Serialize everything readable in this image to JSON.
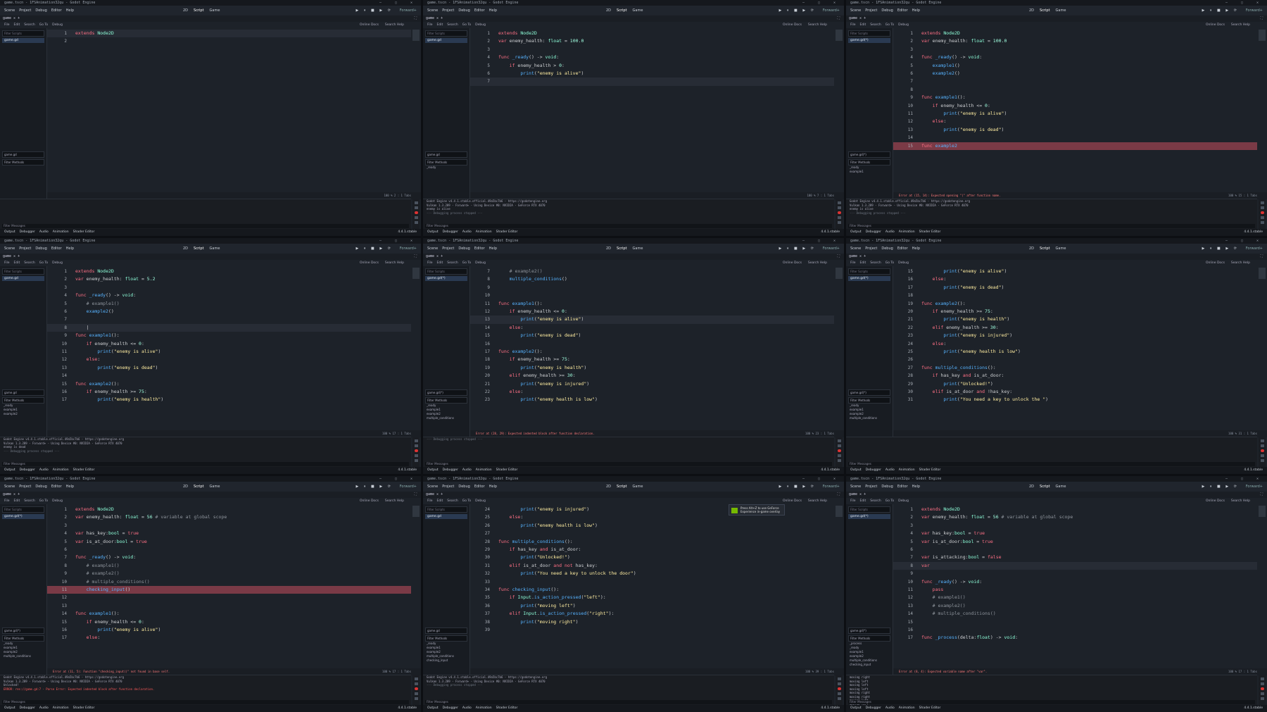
{
  "window_title": "game.tscn - 1FSAnimation32qu - Godot Engine",
  "menu": [
    "Scene",
    "Project",
    "Debug",
    "Editor",
    "Help"
  ],
  "workspaces": [
    "2D",
    "Script",
    "Game"
  ],
  "renderer": "Forward+",
  "tab_name": "game",
  "tab_name_modified": "game",
  "script_menu": [
    "File",
    "Edit",
    "Search",
    "Go To",
    "Debug"
  ],
  "online_docs": "Online Docs",
  "search_help": "Search Help",
  "filter_scripts": "Filter Scripts",
  "filter_methods": "Filter Methods",
  "filter_messages": "Filter Messages",
  "bottom_tabs": [
    "Output",
    "Debugger",
    "Audio",
    "Animation",
    "Shader Editor"
  ],
  "version": "4.4.1.stable",
  "tabs_label": "Tabs",
  "nvidia_popup": "Press Alt+Z to use GeForce Experience in-game overlay",
  "panels": [
    {
      "script_file": "game.gd",
      "line_start": 1,
      "code": [
        "extends Node2D",
        ""
      ],
      "highlight_line": 1,
      "error_line": null,
      "methods": [],
      "status_error": "",
      "output": [],
      "show_nvidia": false
    },
    {
      "script_file": "game.gd",
      "line_start": 1,
      "code": [
        "extends Node2D",
        "var enemy_health: float = 100.0",
        "",
        "func _ready() -> void:",
        "    if enemy_health > 0:",
        "        print(\"enemy is alive\")",
        ""
      ],
      "highlight_line": 7,
      "error_line": null,
      "methods": [
        "_ready"
      ],
      "status_error": "",
      "output": [
        "Godot Engine v4.4.1.stable.official.49a5bc7b6 - https://godotengine.org",
        "Vulkan 1.3.289 - Forward+ - Using Device #0: NVIDIA - GeForce RTX 4070",
        "",
        "enemy is alive",
        "--- Debugging process stopped ---"
      ],
      "show_nvidia": false
    },
    {
      "script_file": "game.gd(*)",
      "line_start": 1,
      "code": [
        "extends Node2D",
        "var enemy_health: float = 100.0",
        "",
        "func _ready() -> void:",
        "    example1()",
        "    example2()",
        "",
        "",
        "func example1():",
        "    if enemy_health <= 0:",
        "        print(\"enemy is alive\")",
        "    else:",
        "        print(\"enemy is dead\")",
        "",
        "func example2"
      ],
      "highlight_line": null,
      "error_line": 15,
      "methods": [
        "_ready",
        "example1"
      ],
      "status_error": "Error at (15, 14): Expected opening \"(\" after function name.",
      "output": [
        "Godot Engine v4.4.1.stable.official.49a5bc7b6 - https://godotengine.org",
        "Vulkan 1.3.289 - Forward+ - Using Device #0: NVIDIA - GeForce RTX 4070",
        "",
        "enemy is alive",
        "--- Debugging process stopped ---"
      ],
      "show_nvidia": false
    },
    {
      "script_file": "game.gd",
      "line_start": 1,
      "code": [
        "extends Node2D",
        "var enemy_health: float = 5.2",
        "",
        "func _ready() -> void:",
        "    # example1()",
        "    example2()",
        "",
        "    |",
        "func example1():",
        "    if enemy_health <= 0:",
        "        print(\"enemy is alive\")",
        "    else:",
        "        print(\"enemy is dead\")",
        "",
        "func example2():",
        "    if enemy_health >= 75:",
        "        print(\"enemy is health\")"
      ],
      "highlight_line": 8,
      "error_line": null,
      "methods": [
        "_ready",
        "example1",
        "example2"
      ],
      "status_error": "",
      "output": [
        "Godot Engine v4.4.1.stable.official.49a5bc7b6 - https://godotengine.org",
        "Vulkan 1.3.289 - Forward+ - Using Device #0: NVIDIA - GeForce RTX 4070",
        "",
        "enemy is dead",
        "--- Debugging process stopped ---"
      ],
      "show_nvidia": false
    },
    {
      "script_file": "game.gd(*)",
      "line_start": 7,
      "code": [
        "    # example2()",
        "    multiple_conditions()",
        "",
        "",
        "func example1():",
        "    if enemy_health <= 0:",
        "        print(\"enemy is alive\")",
        "    else:",
        "        print(\"enemy is dead\")",
        "",
        "func example2():",
        "    if enemy_health >= 75:",
        "        print(\"enemy is health\")",
        "    elif enemy_health >= 30:",
        "        print(\"enemy is injured\")",
        "    else:",
        "        print(\"enemy health is low\")"
      ],
      "highlight_line": 13,
      "error_line": null,
      "methods": [
        "_ready",
        "example1",
        "example2",
        "multiple_conditions"
      ],
      "status_error": "Error at (28, 29): Expected indented block after function declaration.",
      "output": [
        "--- Debugging process stopped ---"
      ],
      "show_nvidia": false
    },
    {
      "script_file": "game.gd(*)",
      "line_start": 15,
      "code": [
        "        print(\"enemy is alive\")",
        "    else:",
        "        print(\"enemy is dead\")",
        "",
        "func example2():",
        "    if enemy_health >= 75:",
        "        print(\"enemy is health\")",
        "    elif enemy_health >= 30:",
        "        print(\"enemy is injured\")",
        "    else:",
        "        print(\"enemy health is low\")",
        "",
        "func multiple_conditions():",
        "    if has_key and is_at_door:",
        "        print(\"Unlocked!\")",
        "    elif is_at_door and !has_key:",
        "        print(\"You need a key to unlock the \")"
      ],
      "highlight_line": null,
      "error_line": null,
      "methods": [
        "_ready",
        "example1",
        "example2",
        "multiple_conditions"
      ],
      "status_error": "",
      "output": [],
      "show_nvidia": false
    },
    {
      "script_file": "game.gd(*)",
      "line_start": 1,
      "code": [
        "extends Node2D",
        "var enemy_health: float = 56 # variable at global scope",
        "",
        "var has_key:bool = true",
        "var is_at_door:bool = true",
        "",
        "func _ready() -> void:",
        "    # example1()",
        "    # example2()",
        "    # multiple_conditions()",
        "    checking_input()",
        "",
        "",
        "func example1():",
        "    if enemy_health <= 0:",
        "        print(\"enemy is alive\")",
        "    else:"
      ],
      "highlight_line": null,
      "error_line": 11,
      "methods": [
        "_ready",
        "example1",
        "example2",
        "multiple_conditions"
      ],
      "status_error": "Error at (11, 5): Function \"checking_input()\" not found in base self.",
      "output": [
        "Godot Engine v4.4.1.stable.official.49a5bc7b6 - https://godotengine.org",
        "Vulkan 1.3.289 - Forward+ - Using Device #0: NVIDIA - GeForce RTX 4070",
        "",
        "Unlocked!",
        "ERROR: res://game.gd:7 - Parse Error: Expected indented block after function declaration."
      ],
      "show_nvidia": false
    },
    {
      "script_file": "game.gd",
      "line_start": 24,
      "code": [
        "        print(\"enemy is injured\")",
        "    else:",
        "        print(\"enemy health is low\")",
        "",
        "func multiple_conditions():",
        "    if has_key and is_at_door:",
        "        print(\"Unlocked!\")",
        "    elif is_at_door and not has_key:",
        "        print(\"You need a key to unlock the door\")",
        "",
        "func checking_input():",
        "    if Input.is_action_pressed(\"left\"):",
        "        print(\"moving left\")",
        "    elif Input.is_action_pressed(\"right\"):",
        "        print(\"moving right\")",
        ""
      ],
      "highlight_line": null,
      "error_line": null,
      "methods": [
        "_ready",
        "example1",
        "example2",
        "multiple_conditions",
        "checking_input"
      ],
      "status_error": "",
      "output": [
        "Godot Engine v4.4.1.stable.official.49a5bc7b6 - https://godotengine.org",
        "Vulkan 1.3.289 - Forward+ - Using Device #0: NVIDIA - GeForce RTX 4070",
        "",
        "--- Debugging process stopped ---"
      ],
      "show_nvidia": true
    },
    {
      "script_file": "game.gd(*)",
      "line_start": 1,
      "code": [
        "extends Node2D",
        "var enemy_health: float = 56 # variable at global scope",
        "",
        "var has_key:bool = true",
        "var is_at_door:bool = true",
        "",
        "var is_attacking:bool = false",
        "var",
        "",
        "func _ready() -> void:",
        "    pass",
        "    # example1()",
        "    # example2()",
        "    # multiple_conditions()",
        "",
        "",
        "func _process(delta:float) -> void:"
      ],
      "highlight_line": 8,
      "error_line": null,
      "methods": [
        "_process",
        "_ready",
        "example1",
        "example2",
        "multiple_conditions",
        "checking_input"
      ],
      "status_error": "Error at (8, 4): Expected variable name after \"var\".",
      "output": [
        "moving right",
        "moving left",
        "moving left",
        "moving left",
        "moving right",
        "moving right",
        "moving left",
        "moving left",
        "moving right",
        "--- Debugging process stopped ---",
        "ERROR: res://game.gd:8 - Parse Error: Expected variable name after \"var\"."
      ],
      "show_nvidia": false
    }
  ]
}
